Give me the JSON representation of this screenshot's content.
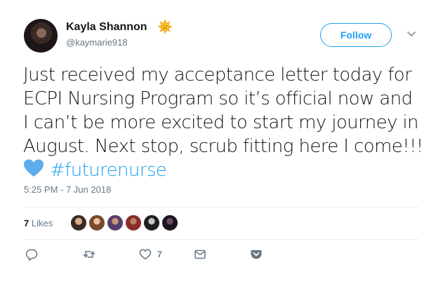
{
  "tweet": {
    "author_name": "Kayla Shannon",
    "author_handle": "@kaymarie918",
    "follow_label": "Follow",
    "text_lines": [
      "Just received my acceptance letter today for",
      "ECPI Nursing Program so it’s official now and",
      "I can’t be more excited to start my journey in",
      "August. Next stop, scrub fitting here I come!!!"
    ],
    "hashtag": "#futurenurse",
    "timestamp": "5:25 PM - 7 Jun 2018",
    "likes_count": "7",
    "likes_label": "Likes",
    "like_action_count": "7",
    "icons": {
      "emoji_after_name": "sun-emoji-icon",
      "emoji_in_text": "blue-heart-emoji-icon",
      "reply": "reply-icon",
      "retweet": "retweet-icon",
      "like": "heart-icon",
      "message": "envelope-icon",
      "more": "chevron-down-icon",
      "pocket": "pocket-icon"
    },
    "colors": {
      "accent": "#1da1f2",
      "secondary_text": "#657786",
      "primary_text": "#14171a",
      "divider": "#e6ecf0"
    }
  }
}
